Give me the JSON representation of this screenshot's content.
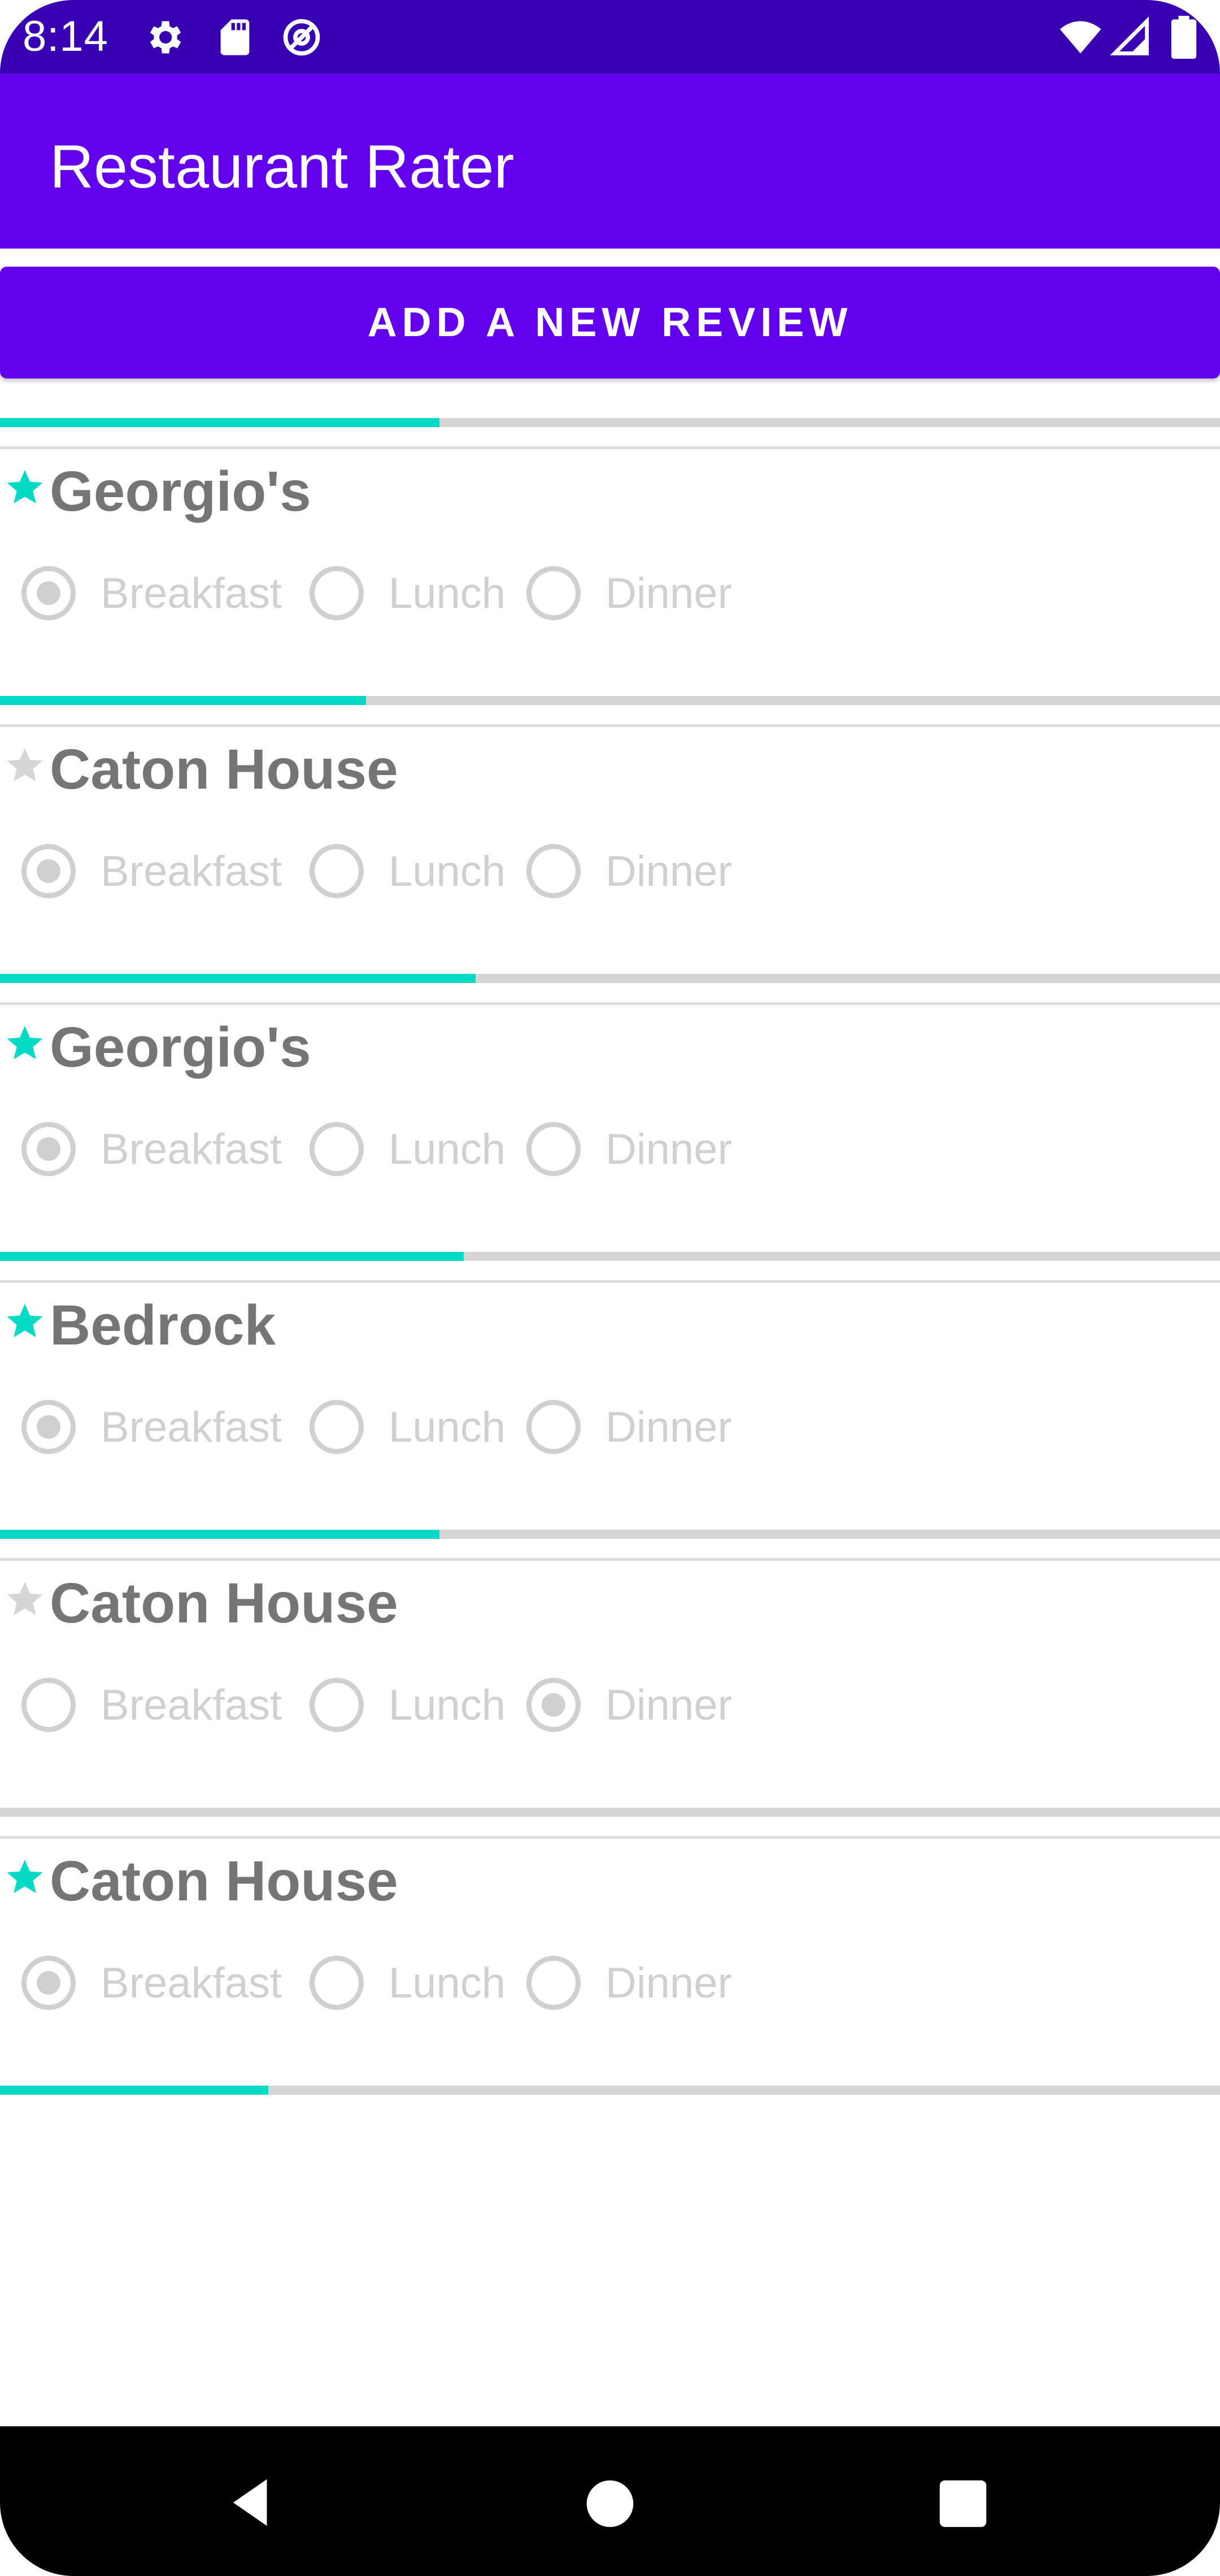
{
  "status_bar": {
    "time": "8:14",
    "left_icons": [
      "gear-icon",
      "sd-card-icon",
      "at-sign-icon"
    ],
    "right_icons": [
      "wifi-icon",
      "cell-signal-icon",
      "battery-icon"
    ]
  },
  "app_bar": {
    "title": "Restaurant Rater"
  },
  "add_button": {
    "label": "ADD A NEW REVIEW"
  },
  "colors": {
    "primary": "#6200ee",
    "primary_dark": "#3700b3",
    "accent": "#03dac5",
    "disabled": "#d0d0d0"
  },
  "meal_options": [
    "Breakfast",
    "Lunch",
    "Dinner"
  ],
  "reviews": [
    {
      "name": "Georgio's",
      "favorite": true,
      "meal": "Breakfast"
    },
    {
      "name": "Caton House",
      "favorite": false,
      "meal": "Breakfast"
    },
    {
      "name": "Georgio's",
      "favorite": true,
      "meal": "Breakfast"
    },
    {
      "name": "Bedrock",
      "favorite": true,
      "meal": "Breakfast"
    },
    {
      "name": "Caton House",
      "favorite": false,
      "meal": "Dinner"
    },
    {
      "name": "Caton House",
      "favorite": true,
      "meal": "Breakfast"
    }
  ],
  "rating_bars": [
    0.36,
    0.3,
    0.39,
    0.38,
    0.36,
    0.0,
    0.22
  ],
  "nav_bar": {
    "buttons": [
      "back-icon",
      "home-icon",
      "recents-icon"
    ]
  }
}
